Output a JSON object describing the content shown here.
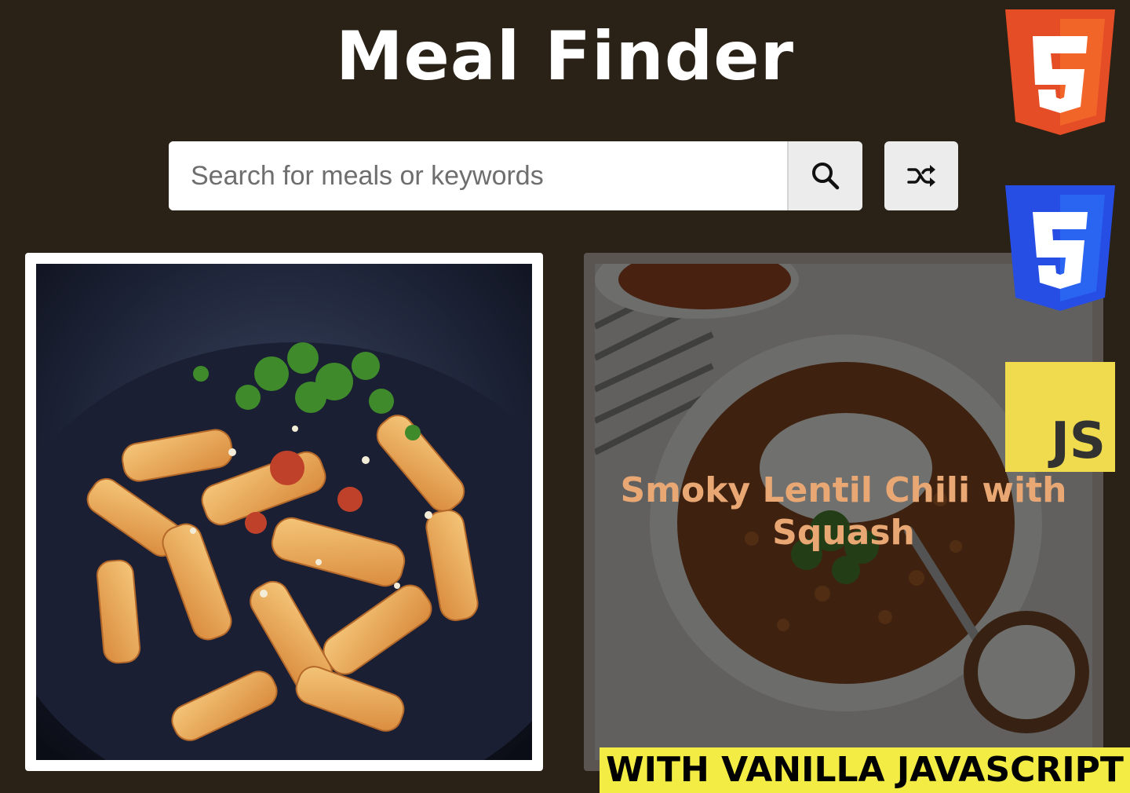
{
  "header": {
    "title": "Meal Finder"
  },
  "search": {
    "placeholder": "Search for meals or keywords",
    "value": "",
    "search_icon": "search-icon",
    "random_icon": "shuffle-icon"
  },
  "meals": [
    {
      "name": "",
      "image": "penne pasta with tomato sauce and parsley in a dark pan"
    },
    {
      "name": "Smoky Lentil Chili with Squash",
      "image": "bowl of lentil chili with yogurt and cilantro"
    }
  ],
  "badges": {
    "html_icon": "html5-logo",
    "css_icon": "css3-logo",
    "js_label": "JS",
    "banner": "WITH VANILLA JAVASCRIPT"
  },
  "colors": {
    "background": "#2a2117",
    "html5": "#e44d26",
    "css3": "#264de4",
    "js": "#f0db4f",
    "banner": "#f2ec45",
    "meal_name": "#e9a774"
  }
}
